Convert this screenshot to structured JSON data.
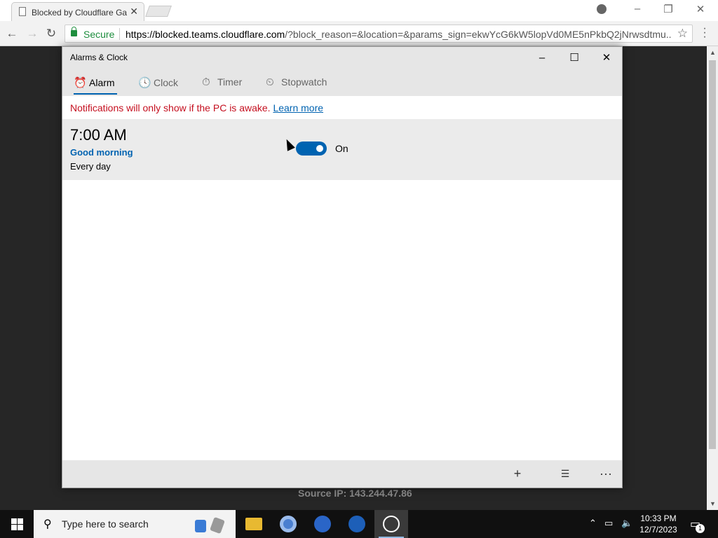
{
  "browser": {
    "tab_title": "Blocked by Cloudflare Ga",
    "tab_close": "✕",
    "secure_label": "Secure",
    "url_host": "https://blocked.teams.cloudflare.com",
    "url_rest": "/?block_reason=&location=&params_sign=ekwYcG6kW5lopVd0ME5nPkbQ2jNrwsdtmu...",
    "source_ip": "Source IP: 143.244.47.86"
  },
  "app": {
    "title": "Alarms & Clock",
    "tabs": [
      {
        "label": "Alarm",
        "icon": "alarm-icon",
        "glyph": "⏰"
      },
      {
        "label": "Clock",
        "icon": "world-clock-icon",
        "glyph": "🕓"
      },
      {
        "label": "Timer",
        "icon": "timer-icon",
        "glyph": "⏱"
      },
      {
        "label": "Stopwatch",
        "icon": "stopwatch-icon",
        "glyph": "⏲"
      }
    ],
    "notice_text": "Notifications will only show if the PC is awake.",
    "notice_link": "Learn more",
    "alarm": {
      "time": "7:00 AM",
      "name": "Good morning",
      "repeat": "Every day",
      "toggle_label": "On",
      "enabled": true
    },
    "bottom_buttons": {
      "add": "+",
      "select": "☰",
      "more": "···"
    }
  },
  "taskbar": {
    "search_placeholder": "Type here to search",
    "time": "10:33 PM",
    "date": "12/7/2023",
    "notification_count": "1"
  },
  "colors": {
    "accent": "#0063b1",
    "notice": "#c50f1f",
    "secure": "#1e8e3e"
  }
}
